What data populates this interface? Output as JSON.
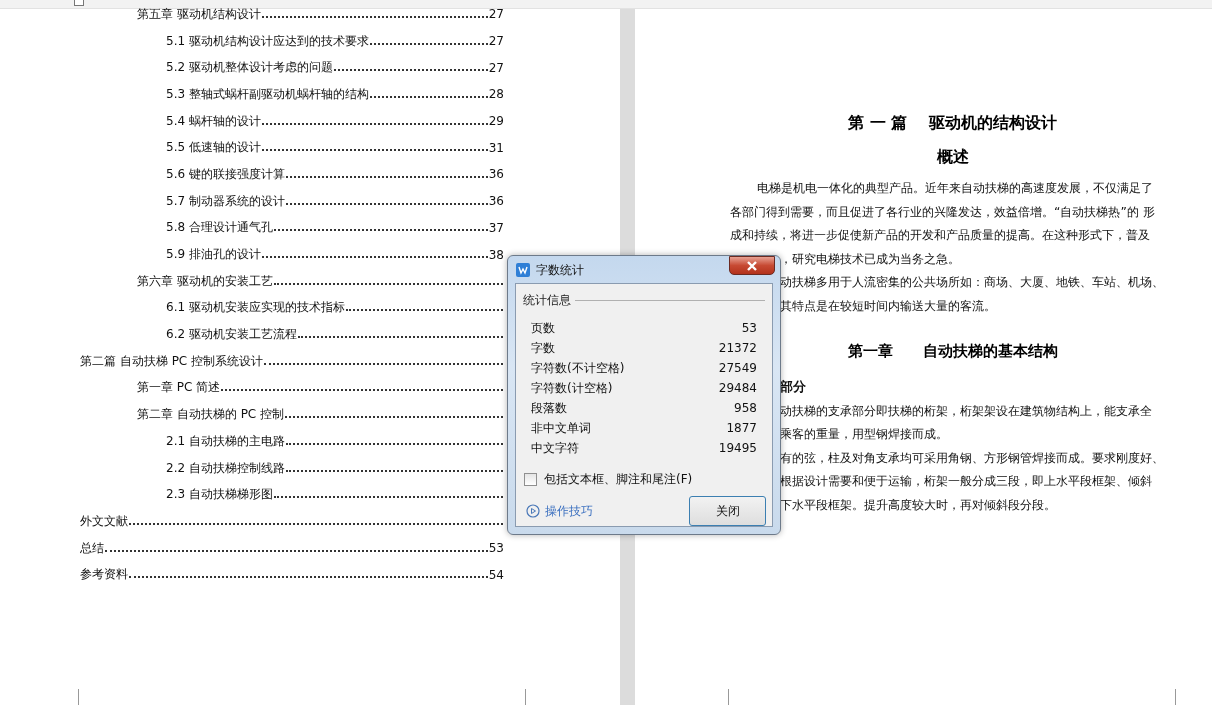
{
  "toc": [
    {
      "children": [
        {
          "title": "第五章 驱动机结构设计",
          "page": "27",
          "children": [
            {
              "title": "5.1 驱动机结构设计应达到的技术要求",
              "page": "27"
            },
            {
              "title": "5.2 驱动机整体设计考虑的问题",
              "page": "27"
            },
            {
              "title": "5.3 整轴式蜗杆副驱动机蜗杆轴的结构",
              "page": "28"
            },
            {
              "title": "5.4 蜗杆轴的设计",
              "page": "29"
            },
            {
              "title": "5.5 低速轴的设计",
              "page": "31"
            },
            {
              "title": "5.6 键的联接强度计算",
              "page": "36"
            },
            {
              "title": "5.7 制动器系统的设计",
              "page": "36"
            },
            {
              "title": "5.8 合理设计通气孔",
              "page": "37"
            },
            {
              "title": "5.9 排油孔的设计",
              "page": "38"
            }
          ]
        },
        {
          "title": "第六章 驱动机的安装工艺",
          "children": [
            {
              "title": "6.1 驱动机安装应实现的技术指标"
            },
            {
              "title": "6.2 驱动机安装工艺流程"
            }
          ]
        }
      ]
    },
    {
      "title": "第二篇 自动扶梯 PC 控制系统设计",
      "children": [
        {
          "title": "第一章 PC 简述"
        },
        {
          "title": "第二章 自动扶梯的 PC 控制",
          "children": [
            {
              "title": "2.1 自动扶梯的主电路"
            },
            {
              "title": "2.2 自动扶梯控制线路"
            },
            {
              "title": "2.3 自动扶梯梯形图"
            }
          ]
        }
      ]
    },
    {
      "title": "外文文献"
    },
    {
      "title": "总结",
      "page": "53"
    },
    {
      "title": "参考资料",
      "page": "54"
    }
  ],
  "document": {
    "part_title": "第 一 篇　 驱动机的结构设计",
    "section_title": "概述",
    "lines": [
      {
        "kind": "indent",
        "text": "电梯是机电一体化的典型产品。近年来自动扶梯的高速度发展，不仅满足了"
      },
      {
        "kind": "full",
        "text": "各部门得到需要，而且促进了各行业的兴隆发达，效益倍增。“自动扶梯热”的 形"
      },
      {
        "kind": "full",
        "text": "成和持续，将进一步促使新产品的开发和产品质量的提高。在这种形式下，普及"
      },
      {
        "kind": "cut",
        "text": "，研究电梯技术已成为当务之急。"
      },
      {
        "kind": "cut",
        "text": "动扶梯多用于人流密集的公共场所如：商场、大厦、地铁、车站、机场、"
      },
      {
        "kind": "cut",
        "text": "其特点是在较短时间内输送大量的客流。"
      },
      {
        "kind": "heading",
        "text": "第一章　　自动扶梯的基本结构"
      },
      {
        "kind": "cut-bold",
        "text": "部分"
      },
      {
        "kind": "cut",
        "text": "动扶梯的支承部分即扶梯的桁架，桁架架设在建筑物结构上，能支承全"
      },
      {
        "kind": "cut",
        "text": "乘客的重量，用型钢焊接而成。"
      },
      {
        "kind": "cut",
        "text": "有的弦，柱及对角支承均可采用角钢、方形钢管焊接而成。要求刚度好、"
      },
      {
        "kind": "cut",
        "text": "根据设计需要和便于运输，桁架一般分成三段，即上水平段框架、倾斜"
      },
      {
        "kind": "cut",
        "text": "下水平段框架。提升高度较大时，再对倾斜段分段。"
      }
    ]
  },
  "dialog": {
    "title": "字数统计",
    "group": "统计信息",
    "stats": [
      {
        "label": "页数",
        "value": "53"
      },
      {
        "label": "字数",
        "value": "21372"
      },
      {
        "label": "字符数(不计空格)",
        "value": "27549"
      },
      {
        "label": "字符数(计空格)",
        "value": "29484"
      },
      {
        "label": "段落数",
        "value": "958"
      },
      {
        "label": "非中文单词",
        "value": "1877"
      },
      {
        "label": "中文字符",
        "value": "19495"
      }
    ],
    "checkbox": {
      "label": "包括文本框、脚注和尾注(F)",
      "checked": false
    },
    "tips_link": "操作技巧",
    "close_button": "关闭"
  }
}
